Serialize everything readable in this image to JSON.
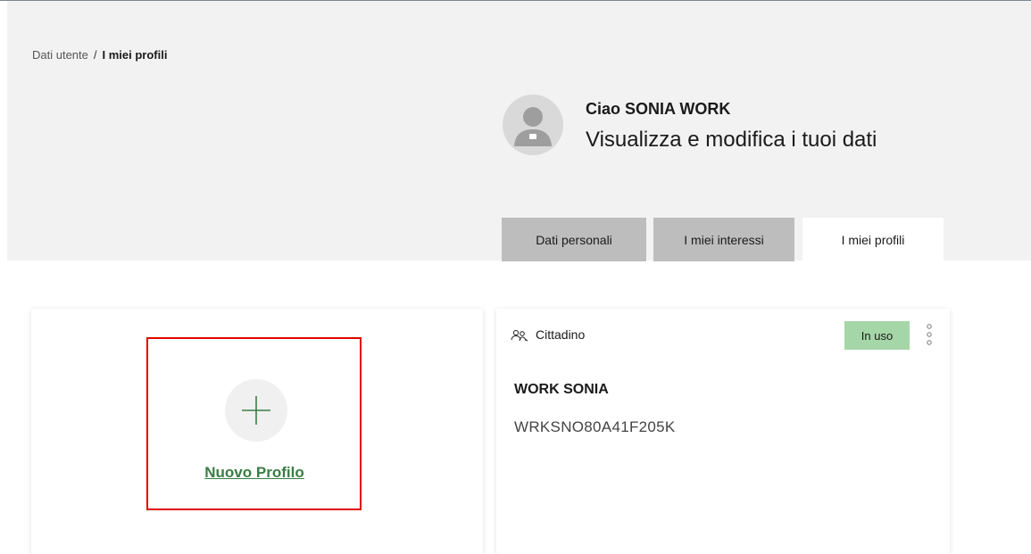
{
  "breadcrumb": {
    "parent": "Dati utente",
    "separator": "/",
    "current": "I miei profili"
  },
  "header": {
    "greeting": "Ciao SONIA WORK",
    "subtitle": "Visualizza e modifica i tuoi dati"
  },
  "tabs": [
    {
      "label": "Dati personali",
      "active": false
    },
    {
      "label": "I miei interessi",
      "active": false
    },
    {
      "label": "I miei profili",
      "active": true
    }
  ],
  "new_profile": {
    "link_label": "Nuovo Profilo",
    "icon": "plus-icon"
  },
  "profile_card": {
    "role_icon": "users-icon",
    "role": "Cittadino",
    "status_badge": "In uso",
    "name": "WORK SONIA",
    "fiscal_code": "WRKSNO80A41F205K",
    "menu_icon": "kebab-menu-icon"
  },
  "colors": {
    "accent_green": "#3a7d44",
    "badge_green": "#a5d6a7",
    "highlight_red": "#e00000",
    "inactive_tab": "#bdbdbd",
    "header_bg": "#f2f2f2"
  }
}
